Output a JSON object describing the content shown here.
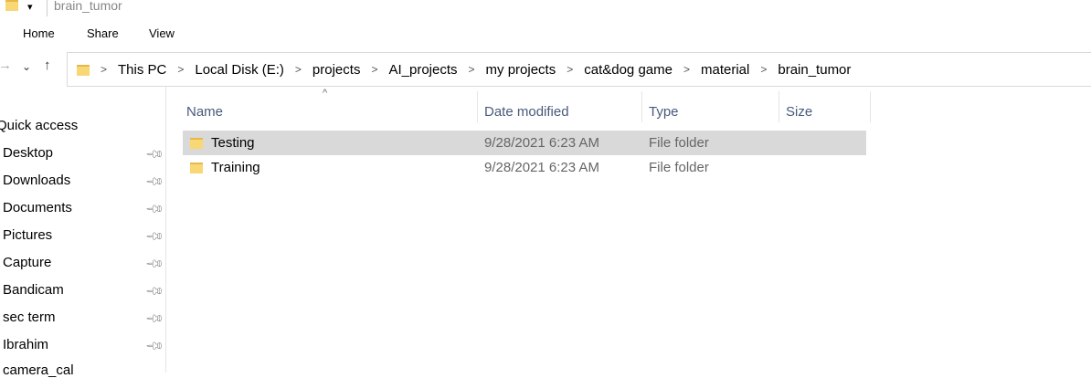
{
  "window": {
    "title": "brain_tumor"
  },
  "ribbon": {
    "tabs": [
      "Home",
      "Share",
      "View"
    ]
  },
  "address": {
    "crumbs": [
      "This PC",
      "Local Disk (E:)",
      "projects",
      "AI_projects",
      "my projects",
      "cat&dog game",
      "material",
      "brain_tumor"
    ]
  },
  "nav": {
    "quick_access": "Quick access",
    "items": [
      "Desktop",
      "Downloads",
      "Documents",
      "Pictures",
      "Capture",
      "Bandicam",
      "sec term",
      "Ibrahim",
      "camera_cal"
    ]
  },
  "columns": {
    "name": "Name",
    "date": "Date modified",
    "type": "Type",
    "size": "Size"
  },
  "files": [
    {
      "name": "Testing",
      "date": "9/28/2021 6:23 AM",
      "type": "File folder",
      "selected": true
    },
    {
      "name": "Training",
      "date": "9/28/2021 6:23 AM",
      "type": "File folder",
      "selected": false
    }
  ],
  "colors": {
    "accent": "#1a62b0",
    "selection": "#d9d9d9",
    "folder": "#f8d775"
  },
  "icons": [
    "folder-icon",
    "dropdown-icon",
    "back-arrow-icon",
    "chevron-down-icon",
    "up-arrow-icon",
    "chevron-right-icon",
    "pin-icon",
    "sort-up-icon"
  ]
}
